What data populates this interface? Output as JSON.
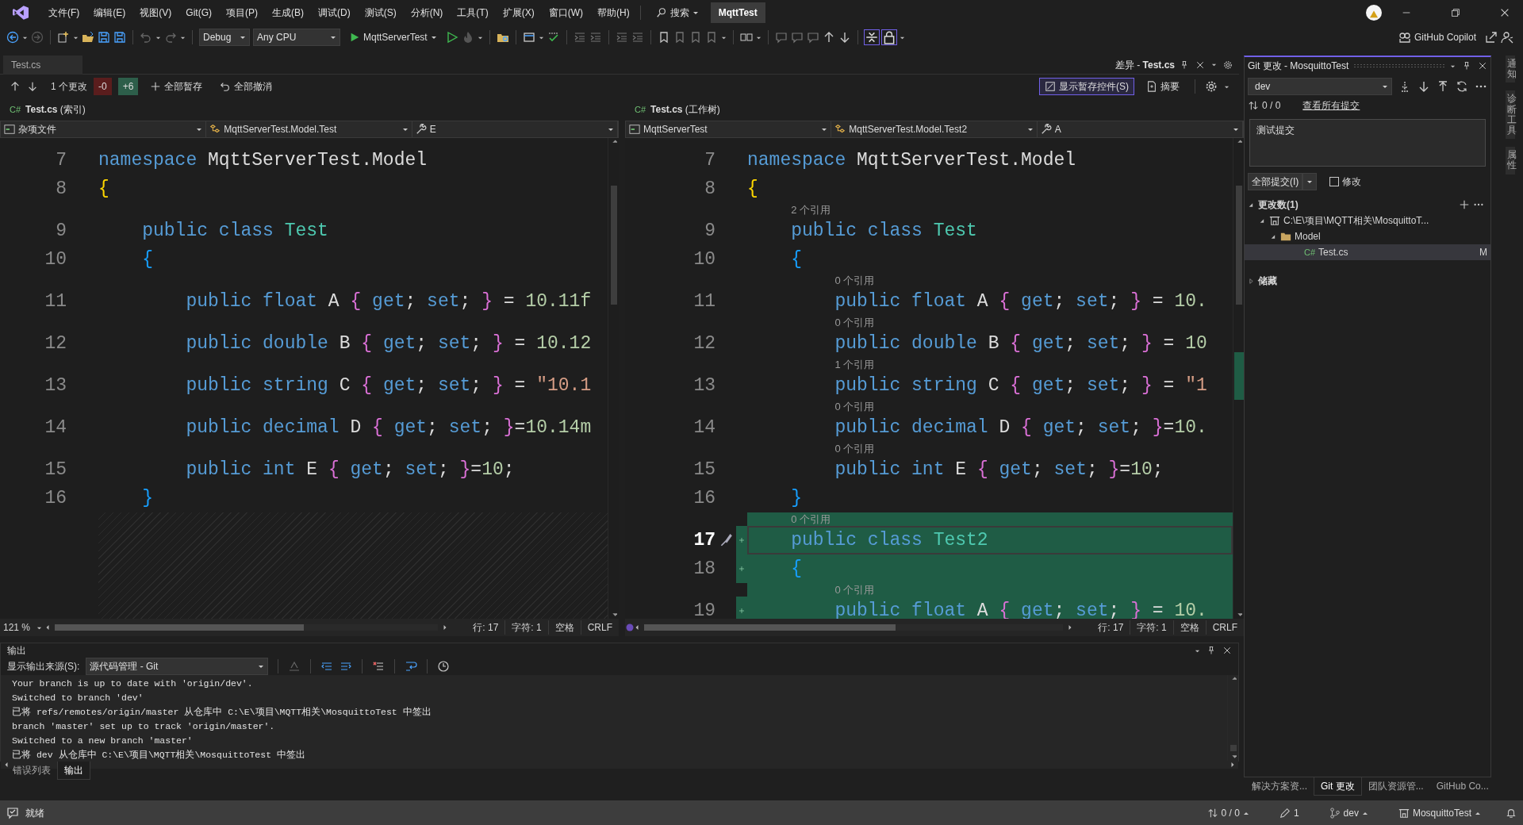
{
  "menu_bar": {
    "items": [
      "文件(F)",
      "编辑(E)",
      "视图(V)",
      "Git(G)",
      "项目(P)",
      "生成(B)",
      "调试(D)",
      "测试(S)",
      "分析(N)",
      "工具(T)",
      "扩展(X)",
      "窗口(W)",
      "帮助(H)"
    ],
    "search": "搜索",
    "solution": "MqttTest"
  },
  "toolbar": {
    "configuration": "Debug",
    "platform": "Any CPU",
    "startup_project": "MqttServerTest",
    "copilot": "GitHub Copilot"
  },
  "document_well": {
    "preview_tab": "Test.cs",
    "active_tab": "差异 - **Test.cs**"
  },
  "diff_toolbar": {
    "change_count": "1 个更改",
    "removed": "-0",
    "added": "+6",
    "stage_all": "全部暂存",
    "undo_all": "全部撤消",
    "staging_controls": {
      "label": "显示暂存控件(S)",
      "checked": true
    },
    "summary": "摘要"
  },
  "panes": [
    {
      "lang": "C#",
      "title": "**Test.cs** (索引)",
      "navigation": [
        "杂项文件",
        "MqttServerTest.Model.Test",
        "E"
      ],
      "rows": [
        {
          "kind": "code",
          "number": "7",
          "tokens": [
            {
              "kind": "keyword",
              "text": "namespace"
            },
            {
              "kind": "plain",
              "text": " MqttServerTest.Model"
            }
          ]
        },
        {
          "kind": "code",
          "number": "8",
          "tokens": [
            {
              "kind": "brace",
              "text": "{"
            }
          ]
        },
        {
          "kind": "spacer"
        },
        {
          "kind": "code",
          "number": "9",
          "tokens": [
            {
              "kind": "keyword",
              "text": "    public class"
            },
            {
              "kind": "type",
              "text": " Test"
            }
          ]
        },
        {
          "kind": "code",
          "number": "10",
          "tokens": [
            {
              "kind": "brace2",
              "text": "    {"
            }
          ]
        },
        {
          "kind": "spacer"
        },
        {
          "kind": "code",
          "number": "11",
          "tokens": [
            {
              "kind": "keyword",
              "text": "        public float"
            },
            {
              "kind": "plain",
              "text": " A "
            },
            {
              "kind": "brace3",
              "text": "{"
            },
            {
              "kind": "keyword",
              "text": " get"
            },
            {
              "kind": "plain",
              "text": ";"
            },
            {
              "kind": "keyword",
              "text": " set"
            },
            {
              "kind": "plain",
              "text": "; "
            },
            {
              "kind": "brace3",
              "text": "}"
            },
            {
              "kind": "plain",
              "text": " = "
            },
            {
              "kind": "number",
              "text": "10.11f"
            }
          ]
        },
        {
          "kind": "spacer"
        },
        {
          "kind": "code",
          "number": "12",
          "tokens": [
            {
              "kind": "keyword",
              "text": "        public double"
            },
            {
              "kind": "plain",
              "text": " B "
            },
            {
              "kind": "brace3",
              "text": "{"
            },
            {
              "kind": "keyword",
              "text": " get"
            },
            {
              "kind": "plain",
              "text": ";"
            },
            {
              "kind": "keyword",
              "text": " set"
            },
            {
              "kind": "plain",
              "text": "; "
            },
            {
              "kind": "brace3",
              "text": "}"
            },
            {
              "kind": "plain",
              "text": " = "
            },
            {
              "kind": "number",
              "text": "10.12"
            }
          ]
        },
        {
          "kind": "spacer"
        },
        {
          "kind": "code",
          "number": "13",
          "tokens": [
            {
              "kind": "keyword",
              "text": "        public string"
            },
            {
              "kind": "plain",
              "text": " C "
            },
            {
              "kind": "brace3",
              "text": "{"
            },
            {
              "kind": "keyword",
              "text": " get"
            },
            {
              "kind": "plain",
              "text": ";"
            },
            {
              "kind": "keyword",
              "text": " set"
            },
            {
              "kind": "plain",
              "text": "; "
            },
            {
              "kind": "brace3",
              "text": "}"
            },
            {
              "kind": "plain",
              "text": " = "
            },
            {
              "kind": "string",
              "text": "\"10.1"
            }
          ]
        },
        {
          "kind": "spacer"
        },
        {
          "kind": "code",
          "number": "14",
          "tokens": [
            {
              "kind": "keyword",
              "text": "        public decimal"
            },
            {
              "kind": "plain",
              "text": " D "
            },
            {
              "kind": "brace3",
              "text": "{"
            },
            {
              "kind": "keyword",
              "text": " get"
            },
            {
              "kind": "plain",
              "text": ";"
            },
            {
              "kind": "keyword",
              "text": " set"
            },
            {
              "kind": "plain",
              "text": "; "
            },
            {
              "kind": "brace3",
              "text": "}"
            },
            {
              "kind": "plain",
              "text": "="
            },
            {
              "kind": "number",
              "text": "10.14m"
            }
          ]
        },
        {
          "kind": "spacer"
        },
        {
          "kind": "code",
          "number": "15",
          "tokens": [
            {
              "kind": "keyword",
              "text": "        public int"
            },
            {
              "kind": "plain",
              "text": " E "
            },
            {
              "kind": "brace3",
              "text": "{"
            },
            {
              "kind": "keyword",
              "text": " get"
            },
            {
              "kind": "plain",
              "text": ";"
            },
            {
              "kind": "keyword",
              "text": " set"
            },
            {
              "kind": "plain",
              "text": "; "
            },
            {
              "kind": "brace3",
              "text": "}"
            },
            {
              "kind": "plain",
              "text": "="
            },
            {
              "kind": "number",
              "text": "10"
            },
            {
              "kind": "plain",
              "text": ";"
            }
          ]
        },
        {
          "kind": "code",
          "number": "16",
          "tokens": [
            {
              "kind": "brace2",
              "text": "    }"
            }
          ]
        },
        {
          "kind": "hatch"
        }
      ],
      "status": {
        "zoom": "121 %",
        "line": "行: 17",
        "column": "字符: 1",
        "indent": "空格",
        "eol": "CRLF"
      }
    },
    {
      "lang": "C#",
      "title": "**Test.cs** (工作树)",
      "navigation": [
        "MqttServerTest",
        "MqttServerTest.Model.Test2",
        "A"
      ],
      "rows": [
        {
          "kind": "code",
          "number": "7",
          "tokens": [
            {
              "kind": "keyword",
              "text": "namespace"
            },
            {
              "kind": "plain",
              "text": " MqttServerTest.Model"
            }
          ]
        },
        {
          "kind": "code",
          "number": "8",
          "tokens": [
            {
              "kind": "brace",
              "text": "{"
            }
          ]
        },
        {
          "kind": "lens",
          "text": "2 个引用"
        },
        {
          "kind": "code",
          "number": "9",
          "tokens": [
            {
              "kind": "keyword",
              "text": "    public class"
            },
            {
              "kind": "type",
              "text": " Test"
            }
          ]
        },
        {
          "kind": "code",
          "number": "10",
          "tokens": [
            {
              "kind": "brace2",
              "text": "    {"
            }
          ]
        },
        {
          "kind": "lens",
          "text": "0 个引用"
        },
        {
          "kind": "code",
          "number": "11",
          "tokens": [
            {
              "kind": "keyword",
              "text": "        public float"
            },
            {
              "kind": "plain",
              "text": " A "
            },
            {
              "kind": "brace3",
              "text": "{"
            },
            {
              "kind": "keyword",
              "text": " get"
            },
            {
              "kind": "plain",
              "text": ";"
            },
            {
              "kind": "keyword",
              "text": " set"
            },
            {
              "kind": "plain",
              "text": "; "
            },
            {
              "kind": "brace3",
              "text": "}"
            },
            {
              "kind": "plain",
              "text": " = "
            },
            {
              "kind": "number",
              "text": "10."
            }
          ]
        },
        {
          "kind": "lens",
          "text": "0 个引用"
        },
        {
          "kind": "code",
          "number": "12",
          "tokens": [
            {
              "kind": "keyword",
              "text": "        public double"
            },
            {
              "kind": "plain",
              "text": " B "
            },
            {
              "kind": "brace3",
              "text": "{"
            },
            {
              "kind": "keyword",
              "text": " get"
            },
            {
              "kind": "plain",
              "text": ";"
            },
            {
              "kind": "keyword",
              "text": " set"
            },
            {
              "kind": "plain",
              "text": "; "
            },
            {
              "kind": "brace3",
              "text": "}"
            },
            {
              "kind": "plain",
              "text": " = "
            },
            {
              "kind": "number",
              "text": "10"
            }
          ]
        },
        {
          "kind": "lens",
          "text": "1 个引用"
        },
        {
          "kind": "code",
          "number": "13",
          "tokens": [
            {
              "kind": "keyword",
              "text": "        public string"
            },
            {
              "kind": "plain",
              "text": " C "
            },
            {
              "kind": "brace3",
              "text": "{"
            },
            {
              "kind": "keyword",
              "text": " get"
            },
            {
              "kind": "plain",
              "text": ";"
            },
            {
              "kind": "keyword",
              "text": " set"
            },
            {
              "kind": "plain",
              "text": "; "
            },
            {
              "kind": "brace3",
              "text": "}"
            },
            {
              "kind": "plain",
              "text": " = "
            },
            {
              "kind": "string",
              "text": "\"1"
            }
          ]
        },
        {
          "kind": "lens",
          "text": "0 个引用"
        },
        {
          "kind": "code",
          "number": "14",
          "tokens": [
            {
              "kind": "keyword",
              "text": "        public decimal"
            },
            {
              "kind": "plain",
              "text": " D "
            },
            {
              "kind": "brace3",
              "text": "{"
            },
            {
              "kind": "keyword",
              "text": " get"
            },
            {
              "kind": "plain",
              "text": ";"
            },
            {
              "kind": "keyword",
              "text": " set"
            },
            {
              "kind": "plain",
              "text": "; "
            },
            {
              "kind": "brace3",
              "text": "}"
            },
            {
              "kind": "plain",
              "text": "="
            },
            {
              "kind": "number",
              "text": "10."
            }
          ]
        },
        {
          "kind": "lens",
          "text": "0 个引用"
        },
        {
          "kind": "code",
          "number": "15",
          "tokens": [
            {
              "kind": "keyword",
              "text": "        public int"
            },
            {
              "kind": "plain",
              "text": " E "
            },
            {
              "kind": "brace3",
              "text": "{"
            },
            {
              "kind": "keyword",
              "text": " get"
            },
            {
              "kind": "plain",
              "text": ";"
            },
            {
              "kind": "keyword",
              "text": " set"
            },
            {
              "kind": "plain",
              "text": "; "
            },
            {
              "kind": "brace3",
              "text": "}"
            },
            {
              "kind": "plain",
              "text": "="
            },
            {
              "kind": "number",
              "text": "10"
            },
            {
              "kind": "plain",
              "text": ";"
            }
          ]
        },
        {
          "kind": "code",
          "number": "16",
          "tokens": [
            {
              "kind": "brace2",
              "text": "    }"
            }
          ]
        },
        {
          "kind": "added_lens",
          "text": "0 个引用"
        },
        {
          "kind": "added_current",
          "number": "17",
          "tokens": [
            {
              "kind": "keyword",
              "text": "    public class"
            },
            {
              "kind": "type",
              "text": " Test2"
            }
          ]
        },
        {
          "kind": "added",
          "number": "18",
          "tokens": [
            {
              "kind": "brace2",
              "text": "    {"
            }
          ]
        },
        {
          "kind": "added_lens",
          "text": "0 个引用"
        },
        {
          "kind": "added",
          "number": "19",
          "tokens": [
            {
              "kind": "keyword",
              "text": "        public float"
            },
            {
              "kind": "plain",
              "text": " A "
            },
            {
              "kind": "brace3",
              "text": "{"
            },
            {
              "kind": "keyword",
              "text": " get"
            },
            {
              "kind": "plain",
              "text": ";"
            },
            {
              "kind": "keyword",
              "text": " set"
            },
            {
              "kind": "plain",
              "text": "; "
            },
            {
              "kind": "brace3",
              "text": "}"
            },
            {
              "kind": "plain",
              "text": " = "
            },
            {
              "kind": "number",
              "text": "10."
            }
          ]
        }
      ],
      "status": {
        "line": "行: 17",
        "column": "字符: 1",
        "indent": "空格",
        "eol": "CRLF"
      }
    }
  ],
  "output": {
    "title": "输出",
    "source_label": "显示输出来源(S):",
    "source": "源代码管理 - Git",
    "lines": [
      "Your branch is up to date with 'origin/dev'.",
      "Switched to branch 'dev'",
      "已将 refs/remotes/origin/master 从仓库中 C:\\E\\项目\\MQTT相关\\MosquittoTest 中签出",
      "branch 'master' set up to track 'origin/master'.",
      "Switched to a new branch 'master'",
      "已将 dev 从仓库中 C:\\E\\项目\\MQTT相关\\MosquittoTest 中签出"
    ]
  },
  "bottom_tabs": [
    {
      "label": "错误列表",
      "selected": false
    },
    {
      "label": "输出",
      "selected": true
    }
  ],
  "git_changes": {
    "title": "Git 更改 - MosquittoTest",
    "branch": "dev",
    "sync": "0 / 0",
    "view_all": "查看所有提交",
    "message": "测试提交",
    "commit_button": "全部提交(I)",
    "amend": {
      "label": "修改",
      "checked": false
    },
    "changes": {
      "label": "更改数(1)",
      "expanded": true,
      "children": [
        {
          "kind": "repo",
          "label": "C:\\E\\项目\\MQTT相关\\MosquittoT...",
          "expanded": true,
          "children": [
            {
              "kind": "folder",
              "label": "Model",
              "expanded": true,
              "children": [
                {
                  "kind": "file",
                  "lang": "C#",
                  "label": "Test.cs",
                  "status": "M",
                  "selected": true
                }
              ]
            }
          ]
        }
      ]
    },
    "stashes": {
      "label": "储藏",
      "expanded": false
    }
  },
  "side_tabs": [
    {
      "label": "解决方案资...",
      "selected": false
    },
    {
      "label": "Git 更改",
      "selected": true
    },
    {
      "label": "团队资源管...",
      "selected": false
    },
    {
      "label": "GitHub Co...",
      "selected": false
    }
  ],
  "tool_strip": [
    "通知",
    "诊断工具",
    "属性"
  ],
  "status_bar": {
    "state": "就绪",
    "sync": "0 / 0",
    "pending": "1",
    "branch": "dev",
    "repository": "MosquittoTest"
  }
}
